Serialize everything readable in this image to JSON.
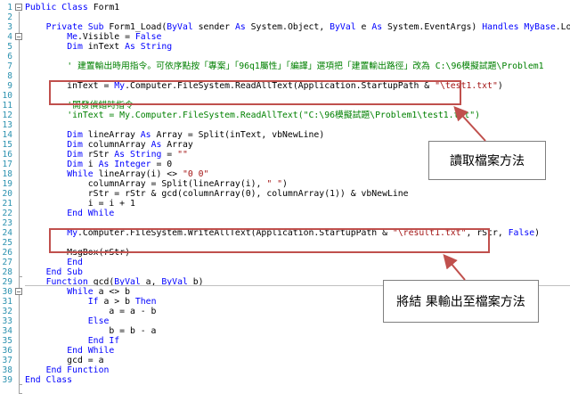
{
  "lines": [
    {
      "n": "1",
      "segs": [
        [
          "kw",
          "Public Class "
        ],
        [
          "",
          "Form1"
        ]
      ]
    },
    {
      "n": "2",
      "segs": []
    },
    {
      "n": "3",
      "segs": [
        [
          "",
          "    "
        ],
        [
          "kw",
          "Private Sub "
        ],
        [
          "",
          "Form1_Load("
        ],
        [
          "kw",
          "ByVal "
        ],
        [
          "",
          "sender "
        ],
        [
          "kw",
          "As "
        ],
        [
          "",
          "System.Object, "
        ],
        [
          "kw",
          "ByVal "
        ],
        [
          "",
          "e "
        ],
        [
          "kw",
          "As "
        ],
        [
          "",
          "System.EventArgs) "
        ],
        [
          "kw",
          "Handles "
        ],
        [
          "kw",
          "MyBase"
        ],
        [
          "",
          ".Load"
        ]
      ]
    },
    {
      "n": "4",
      "segs": [
        [
          "",
          "        "
        ],
        [
          "kw",
          "Me"
        ],
        [
          "",
          ".Visible = "
        ],
        [
          "kw",
          "False"
        ]
      ]
    },
    {
      "n": "5",
      "segs": [
        [
          "",
          "        "
        ],
        [
          "kw",
          "Dim "
        ],
        [
          "",
          "inText "
        ],
        [
          "kw",
          "As String"
        ]
      ]
    },
    {
      "n": "6",
      "segs": []
    },
    {
      "n": "7",
      "segs": [
        [
          "",
          "        "
        ],
        [
          "cm",
          "' 建置輸出時用指令。可依序點按「專案」「96q1屬性」「編譯」選項把「建置輸出路徑」改為 C:\\96模擬試題\\Problem1"
        ]
      ]
    },
    {
      "n": "8",
      "segs": []
    },
    {
      "n": "9",
      "segs": [
        [
          "",
          "        inText = "
        ],
        [
          "kw",
          "My"
        ],
        [
          "",
          ".Computer.FileSystem.ReadAllText(Application.StartupPath & "
        ],
        [
          "st",
          "\"\\test1.txt\""
        ],
        [
          "",
          ")"
        ]
      ]
    },
    {
      "n": "10",
      "segs": []
    },
    {
      "n": "11",
      "segs": [
        [
          "",
          "        "
        ],
        [
          "cm",
          "'開發偵錯時指令"
        ]
      ]
    },
    {
      "n": "12",
      "segs": [
        [
          "",
          "        "
        ],
        [
          "cm",
          "'inText = My.Computer.FileSystem.ReadAllText(\"C:\\96模擬試題\\Problem1\\test1.txt\")"
        ]
      ]
    },
    {
      "n": "13",
      "segs": []
    },
    {
      "n": "14",
      "segs": [
        [
          "",
          "        "
        ],
        [
          "kw",
          "Dim "
        ],
        [
          "",
          "lineArray "
        ],
        [
          "kw",
          "As "
        ],
        [
          "",
          "Array = Split(inText, vbNewLine)"
        ]
      ]
    },
    {
      "n": "15",
      "segs": [
        [
          "",
          "        "
        ],
        [
          "kw",
          "Dim "
        ],
        [
          "",
          "columnArray "
        ],
        [
          "kw",
          "As "
        ],
        [
          "",
          "Array"
        ]
      ]
    },
    {
      "n": "16",
      "segs": [
        [
          "",
          "        "
        ],
        [
          "kw",
          "Dim "
        ],
        [
          "",
          "rStr "
        ],
        [
          "kw",
          "As String "
        ],
        [
          "",
          "= "
        ],
        [
          "st",
          "\"\""
        ]
      ]
    },
    {
      "n": "17",
      "segs": [
        [
          "",
          "        "
        ],
        [
          "kw",
          "Dim "
        ],
        [
          "",
          "i "
        ],
        [
          "kw",
          "As Integer "
        ],
        [
          "",
          "= 0"
        ]
      ]
    },
    {
      "n": "18",
      "segs": [
        [
          "",
          "        "
        ],
        [
          "kw",
          "While "
        ],
        [
          "",
          "lineArray(i) <> "
        ],
        [
          "st",
          "\"0 0\""
        ]
      ]
    },
    {
      "n": "19",
      "segs": [
        [
          "",
          "            columnArray = Split(lineArray(i), "
        ],
        [
          "st",
          "\" \""
        ],
        [
          "",
          ")"
        ]
      ]
    },
    {
      "n": "20",
      "segs": [
        [
          "",
          "            rStr = rStr & gcd(columnArray(0), columnArray(1)) & vbNewLine"
        ]
      ]
    },
    {
      "n": "21",
      "segs": [
        [
          "",
          "            i = i + 1"
        ]
      ]
    },
    {
      "n": "22",
      "segs": [
        [
          "",
          "        "
        ],
        [
          "kw",
          "End While"
        ]
      ]
    },
    {
      "n": "23",
      "segs": []
    },
    {
      "n": "24",
      "segs": [
        [
          "",
          "        "
        ],
        [
          "kw",
          "My"
        ],
        [
          "",
          ".Computer.FileSystem.WriteAllText(Application.StartupPath & "
        ],
        [
          "st",
          "\"\\result1.txt\""
        ],
        [
          "",
          ", rStr, "
        ],
        [
          "kw",
          "False"
        ],
        [
          "",
          ")"
        ]
      ]
    },
    {
      "n": "25",
      "segs": []
    },
    {
      "n": "26",
      "segs": [
        [
          "",
          "        MsgBox(rStr)"
        ]
      ]
    },
    {
      "n": "27",
      "segs": [
        [
          "",
          "        "
        ],
        [
          "kw",
          "End"
        ]
      ]
    },
    {
      "n": "28",
      "segs": [
        [
          "",
          "    "
        ],
        [
          "kw",
          "End Sub"
        ]
      ]
    },
    {
      "n": "29",
      "segs": [
        [
          "",
          "    "
        ],
        [
          "kw",
          "Function "
        ],
        [
          "",
          "gcd("
        ],
        [
          "kw",
          "ByVal "
        ],
        [
          "",
          "a, "
        ],
        [
          "kw",
          "ByVal "
        ],
        [
          "",
          "b)"
        ]
      ]
    },
    {
      "n": "30",
      "segs": [
        [
          "",
          "        "
        ],
        [
          "kw",
          "While "
        ],
        [
          "",
          "a <> b"
        ]
      ]
    },
    {
      "n": "31",
      "segs": [
        [
          "",
          "            "
        ],
        [
          "kw",
          "If "
        ],
        [
          "",
          "a > b "
        ],
        [
          "kw",
          "Then"
        ]
      ]
    },
    {
      "n": "32",
      "segs": [
        [
          "",
          "                a = a - b"
        ]
      ]
    },
    {
      "n": "33",
      "segs": [
        [
          "",
          "            "
        ],
        [
          "kw",
          "Else"
        ]
      ]
    },
    {
      "n": "34",
      "segs": [
        [
          "",
          "                b = b - a"
        ]
      ]
    },
    {
      "n": "35",
      "segs": [
        [
          "",
          "            "
        ],
        [
          "kw",
          "End If"
        ]
      ]
    },
    {
      "n": "36",
      "segs": [
        [
          "",
          "        "
        ],
        [
          "kw",
          "End While"
        ]
      ]
    },
    {
      "n": "37",
      "segs": [
        [
          "",
          "        gcd = a"
        ]
      ]
    },
    {
      "n": "38",
      "segs": [
        [
          "",
          "    "
        ],
        [
          "kw",
          "End Function"
        ]
      ]
    },
    {
      "n": "39",
      "segs": [
        [
          "kw",
          "End Class"
        ]
      ]
    }
  ],
  "annotations": {
    "read_method": "讀取檔案方法",
    "write_method": "將結 果輸出至檔案方法"
  },
  "colors": {
    "keyword": "#0000ff",
    "comment": "#008000",
    "string": "#a31515",
    "line_number": "#2b91af",
    "callout_border": "#c0504d"
  }
}
